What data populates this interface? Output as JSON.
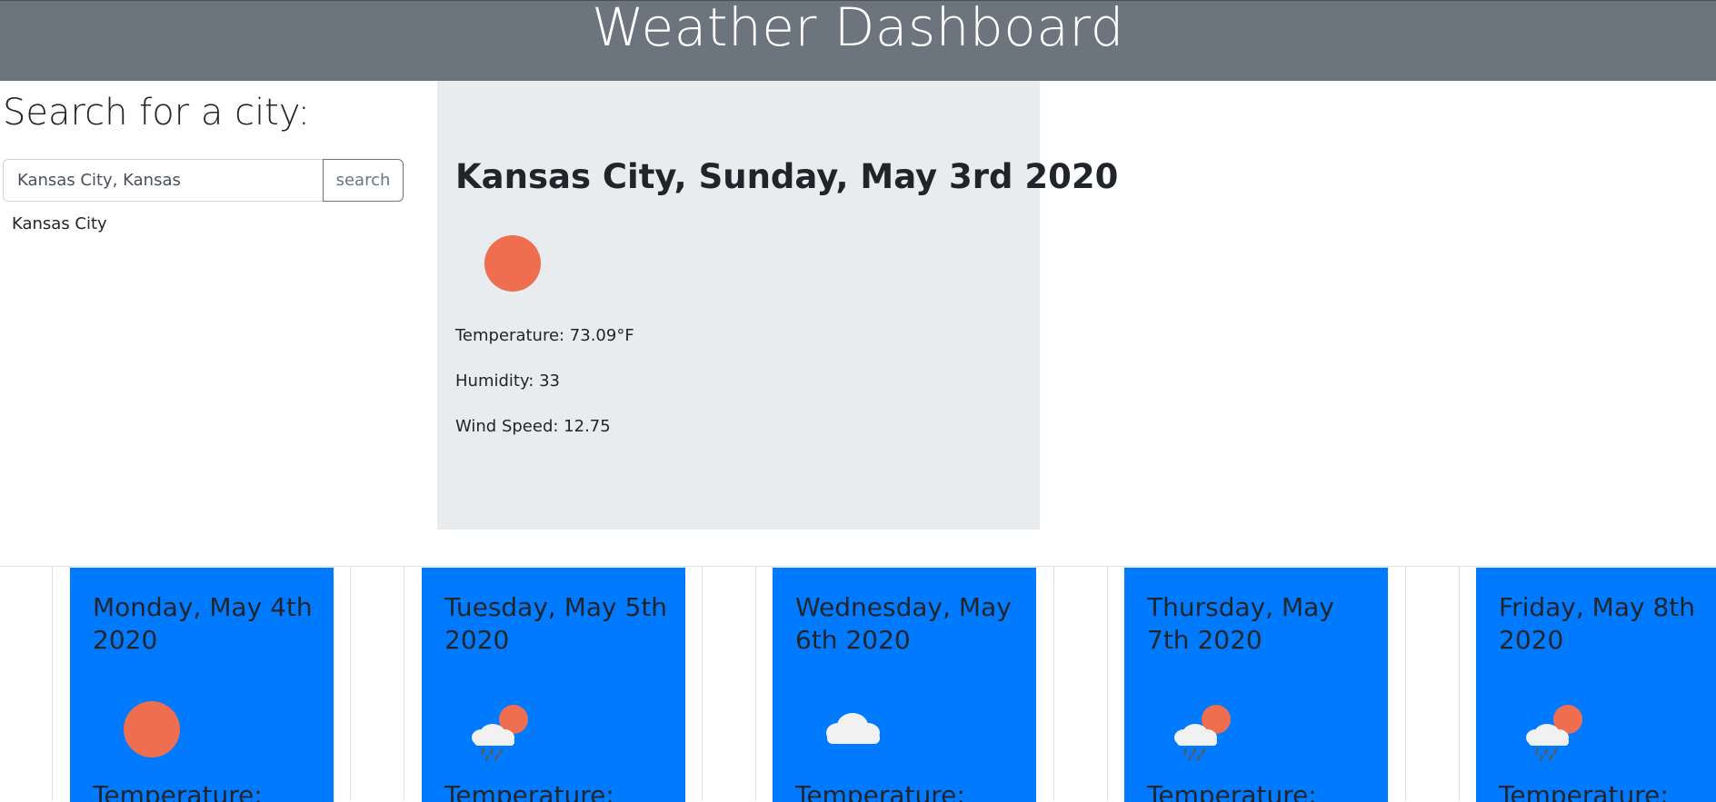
{
  "header": {
    "title": "Weather Dashboard"
  },
  "search": {
    "heading": "Search for a city:",
    "input_value": "Kansas City, Kansas",
    "button_label": "search",
    "history": [
      "Kansas City"
    ]
  },
  "current": {
    "title": "Kansas City, Sunday, May 3rd 2020",
    "icon": "sun-icon",
    "temperature": "Temperature: 73.09°F",
    "humidity": "Humidity: 33",
    "wind": "Wind Speed: 12.75"
  },
  "forecast": [
    {
      "date": "Monday, May 4th 2020",
      "icon": "sun-icon",
      "temp_label": "Temperature:"
    },
    {
      "date": "Tuesday, May 5th 2020",
      "icon": "sun-rain-cloud-icon",
      "temp_label": "Temperature:"
    },
    {
      "date": "Wednesday, May 6th 2020",
      "icon": "cloud-icon",
      "temp_label": "Temperature:"
    },
    {
      "date": "Thursday, May 7th 2020",
      "icon": "sun-rain-cloud-icon",
      "temp_label": "Temperature:"
    },
    {
      "date": "Friday, May 8th 2020",
      "icon": "sun-rain-cloud-icon",
      "temp_label": "Temperature:"
    }
  ],
  "colors": {
    "header_bg": "#6c757d",
    "current_card_bg": "#e9ecef",
    "forecast_card_bg": "#007bff",
    "sun": "#ee6e4f",
    "cloud": "#f1f1f1"
  }
}
